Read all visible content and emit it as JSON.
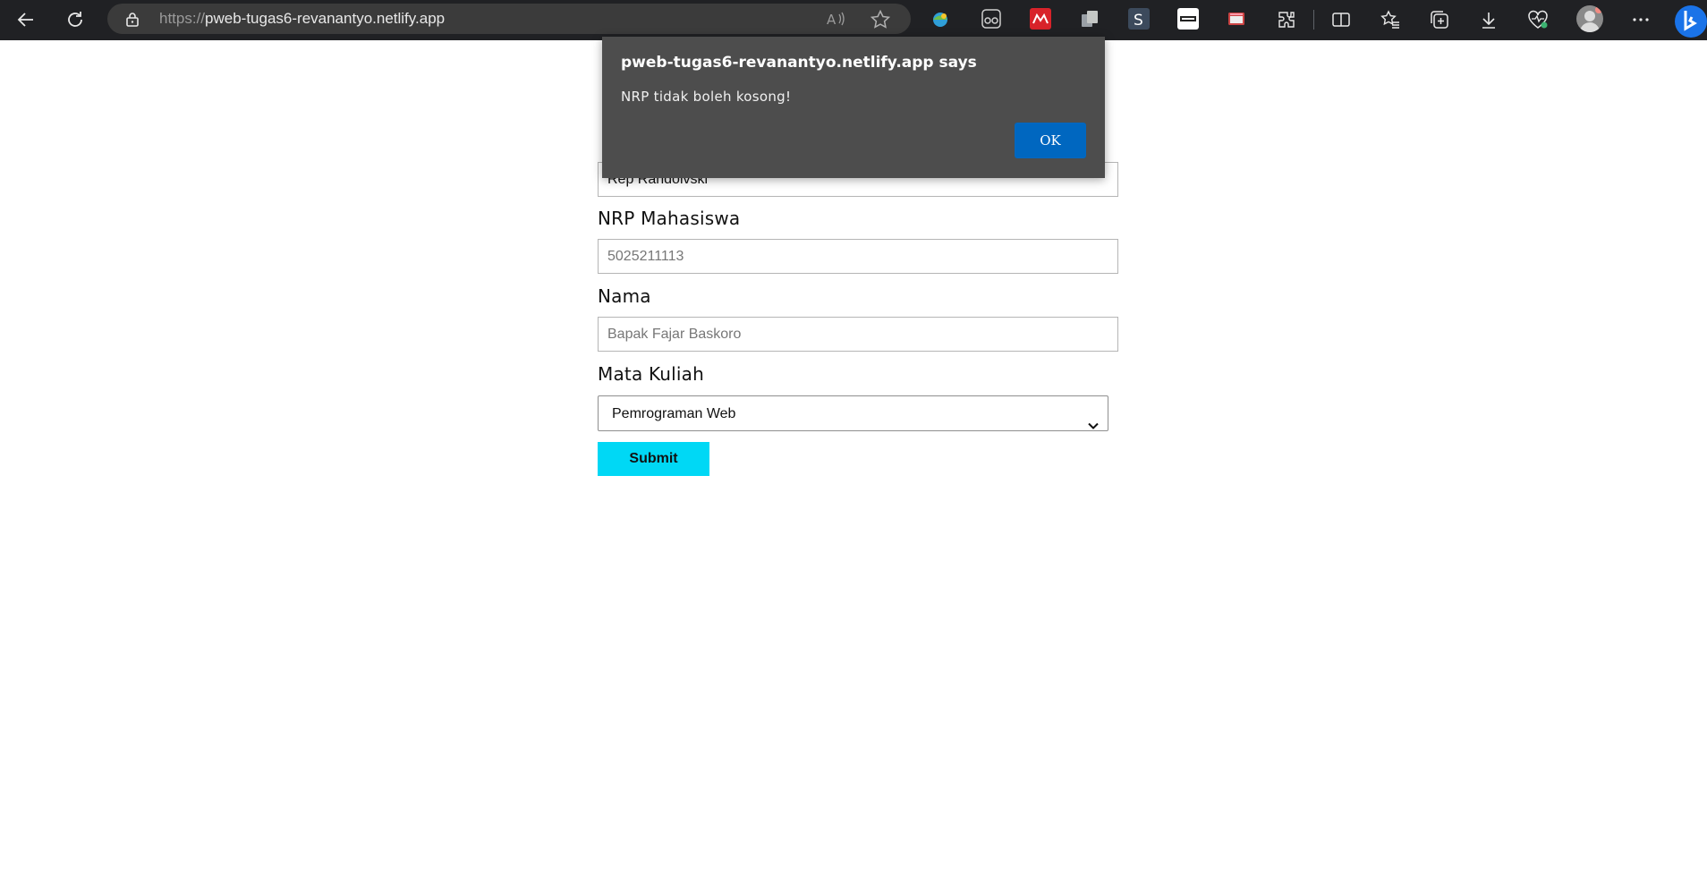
{
  "browser": {
    "url_protocol": "https://",
    "url_host": "pweb-tugas6-revanantyo.netlify.app",
    "icons": [
      "back-icon",
      "refresh-icon",
      "lock-icon",
      "read-aloud-icon",
      "favorite-star-icon",
      "extension-icon",
      "split-screen-icon",
      "favorites-icon",
      "collections-icon",
      "downloads-icon",
      "browser-essentials-icon",
      "profile-avatar",
      "more-icon",
      "bing-icon"
    ]
  },
  "form": {
    "field1_value": "Rep Randolvski",
    "nrp_label": "NRP Mahasiswa",
    "nrp_placeholder": "5025211113",
    "nama_label": "Nama",
    "nama_placeholder": "Bapak Fajar Baskoro",
    "matkul_label": "Mata Kuliah",
    "matkul_selected": "Pemrograman Web",
    "submit_label": "Submit"
  },
  "alert": {
    "title": "pweb-tugas6-revanantyo.netlify.app says",
    "message": "NRP tidak boleh kosong!",
    "ok_label": "OK",
    "ok_color": "#0067c0"
  },
  "colors": {
    "submit_bg": "#00d8f5",
    "chrome_bg": "#202124"
  }
}
